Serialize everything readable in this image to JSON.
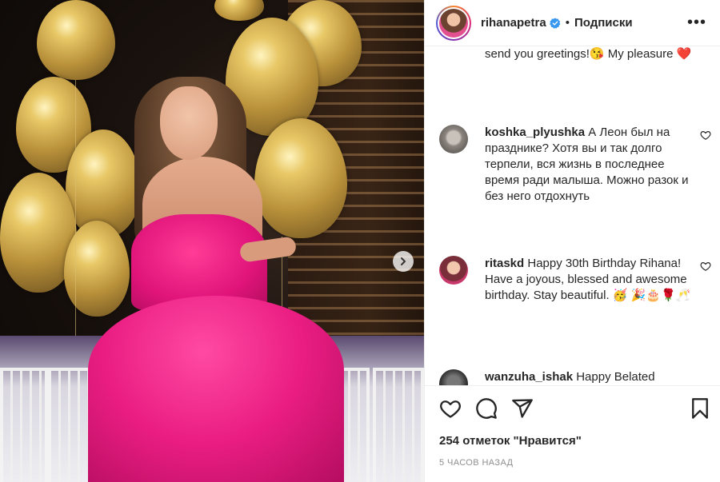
{
  "post": {
    "username": "rihanapetra",
    "follow_label": "Подписки",
    "dot": "•",
    "more_label": "•••"
  },
  "comments": {
    "partial_top": "send you greetings!😘 My pleasure ❤️",
    "items": [
      {
        "user": "koshka_plyushka",
        "text": "А Леон был на празднике? Хотя вы и так долго терпели, вся жизнь в последнее время ради малыша. Можно разок и без него отдохнуть"
      },
      {
        "user": "ritaskd",
        "text": "Happy 30th Birthday Rihana! Have a joyous, blessed and awesome birthday. Stay beautiful. 🥳 🎉🎂🌹🥂"
      },
      {
        "user": "wanzuha_ishak",
        "text": "Happy Belated"
      }
    ]
  },
  "footer": {
    "likes": "254 отметок \"Нравится\"",
    "time": "5 ЧАСОВ НАЗАД"
  },
  "icons": [
    "heart-icon",
    "comment-icon",
    "share-icon",
    "bookmark-icon",
    "verified-badge-icon",
    "chevron-right-icon",
    "more-icon"
  ],
  "colors": {
    "verified": "#3897f0",
    "text": "#262626",
    "muted": "#8e8e8e",
    "dress": "#e0147a"
  }
}
